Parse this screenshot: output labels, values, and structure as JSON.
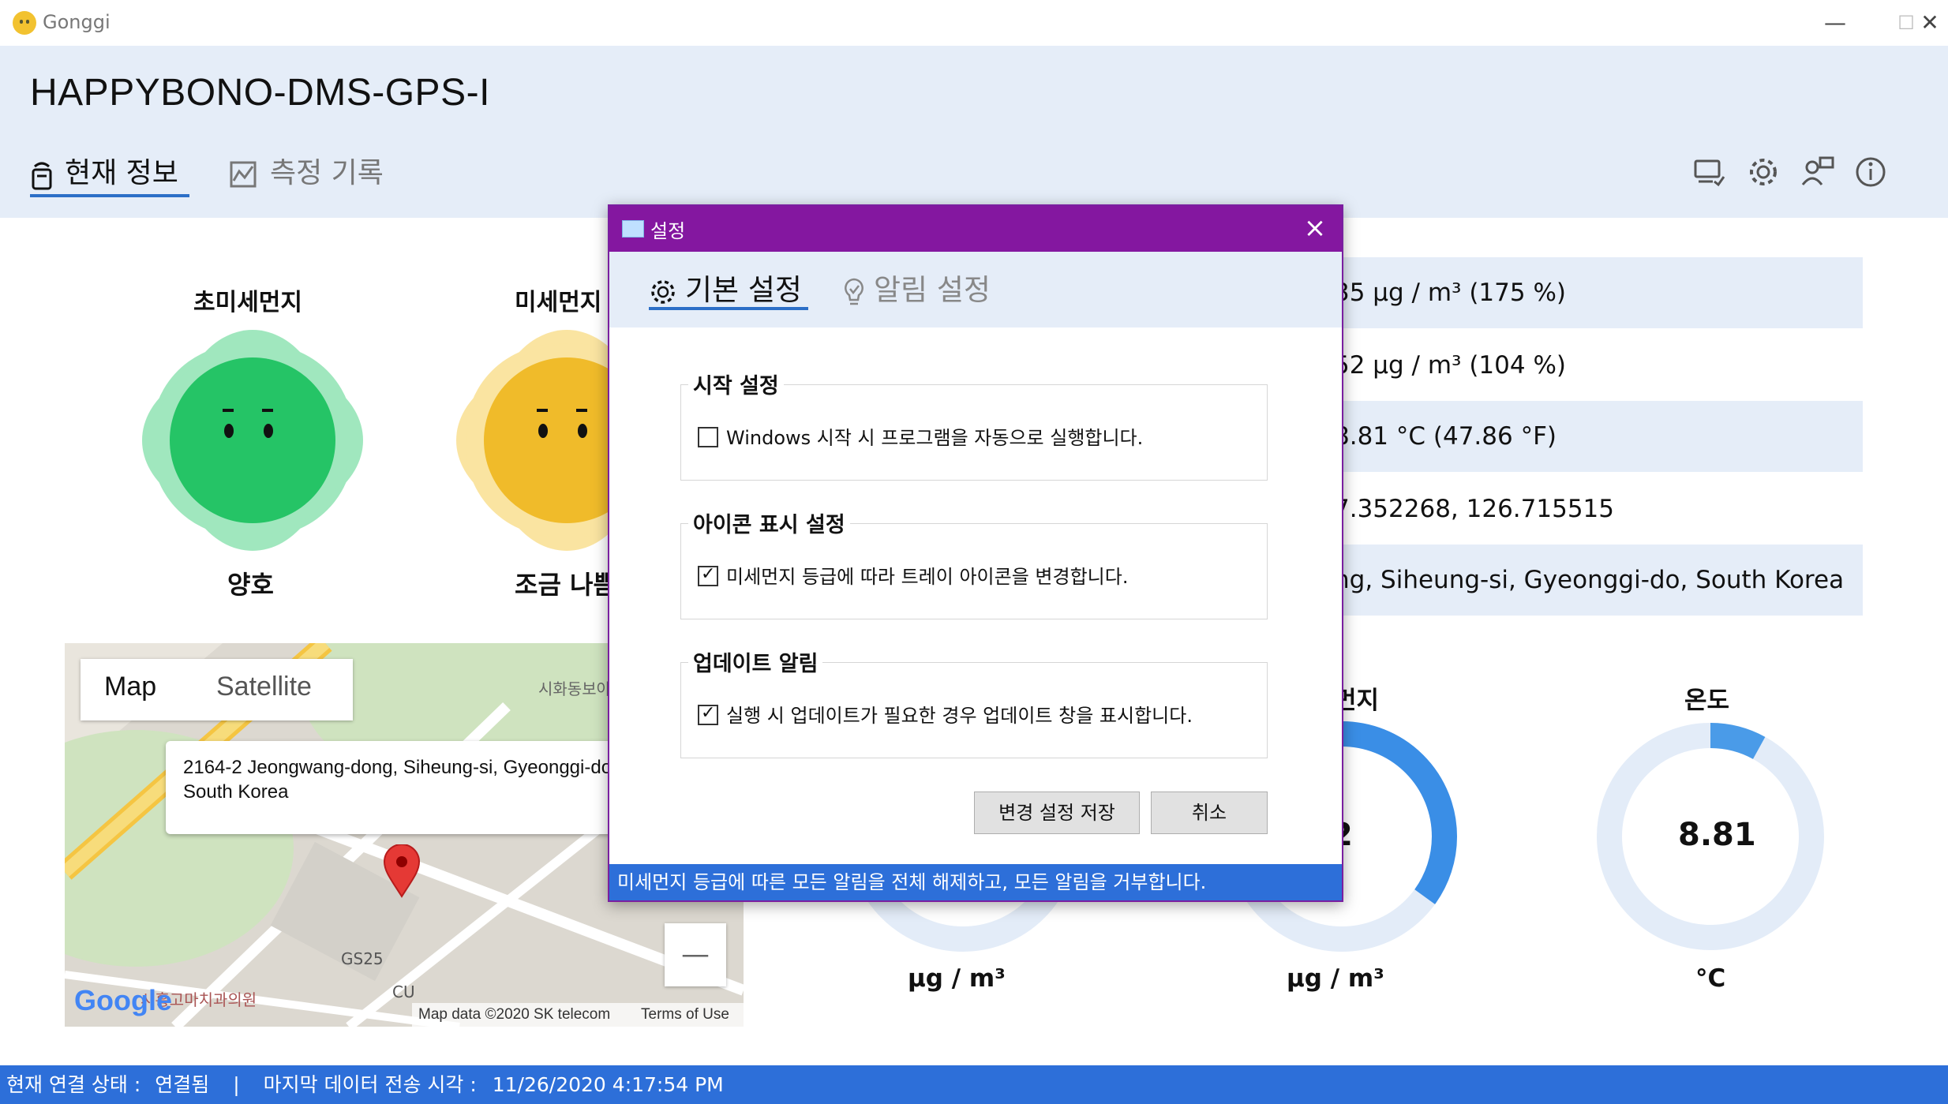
{
  "app": {
    "title": "Gonggi"
  },
  "header": {
    "device_name": "HAPPYBONO-DMS-GPS-I",
    "tabs": [
      {
        "label": "현재 정보"
      },
      {
        "label": "측정 기록"
      }
    ]
  },
  "gauges": [
    {
      "label": "초미세먼지",
      "status": "양호",
      "color": "#2ecc71"
    },
    {
      "label": "미세먼지",
      "status": "조금 나쁨",
      "color": "#f4c430"
    }
  ],
  "info_rows": [
    "35 µg / m³  (175 %)",
    "52 µg / m³ (104 %)",
    "8.81 °C (47.86 °F)",
    "7.352268, 126.715515",
    "ng, Siheung-si, Gyeonggi-do, South Korea"
  ],
  "map": {
    "type_buttons": [
      "Map",
      "Satellite"
    ],
    "popup_address": "2164-2 Jeongwang-dong, Siheung-si, Gyeonggi-do, South Korea",
    "labels": {
      "apartment": "시화동보아파트",
      "store": "GS25",
      "cu": "CU",
      "clinic": "시흥고마치과의원"
    },
    "google": "Google",
    "attribution": "Map data ©2020 SK telecom",
    "terms": "Terms of Use",
    "zoom_out": "—"
  },
  "donuts": [
    {
      "label": "",
      "value_text": "",
      "unit": "µg / m³",
      "fraction": 0.25
    },
    {
      "label": "먼지",
      "value_text": "2",
      "unit": "µg / m³",
      "fraction": 0.35
    },
    {
      "label": "온도",
      "value_text": "8.81",
      "unit": "°C",
      "fraction": 0.08
    }
  ],
  "status_bar": {
    "connection_label": "현재 연결 상태 :",
    "connection_value": "연결됨",
    "separator": "|",
    "last_sent_label": "마지막 데이터 전송 시각 :",
    "last_sent_value": "11/26/2020  4:17:54 PM"
  },
  "dialog": {
    "title": "설정",
    "tabs": [
      {
        "label": "기본 설정"
      },
      {
        "label": "알림 설정"
      }
    ],
    "groups": [
      {
        "title": "시작 설정",
        "checkbox_label": "Windows 시작 시 프로그램을 자동으로 실행합니다.",
        "checked": false
      },
      {
        "title": "아이콘 표시 설정",
        "checkbox_label": "미세먼지 등급에 따라 트레이 아이콘을 변경합니다.",
        "checked": true
      },
      {
        "title": "업데이트 알림",
        "checkbox_label": "실행 시 업데이트가 필요한 경우 업데이트 창을 표시합니다.",
        "checked": true
      }
    ],
    "save_button": "변경 설정 저장",
    "cancel_button": "취소",
    "status_text": "미세먼지 등급에 따른 모든 알림을 전체 해제하고, 모든 알림을 거부합니다."
  },
  "colors": {
    "accent": "#2d6fd9",
    "dialog": "#8417a0",
    "header_bg": "#e5edf8",
    "donut": "#3a8ee6",
    "donut_track": "#e3ecf8"
  }
}
